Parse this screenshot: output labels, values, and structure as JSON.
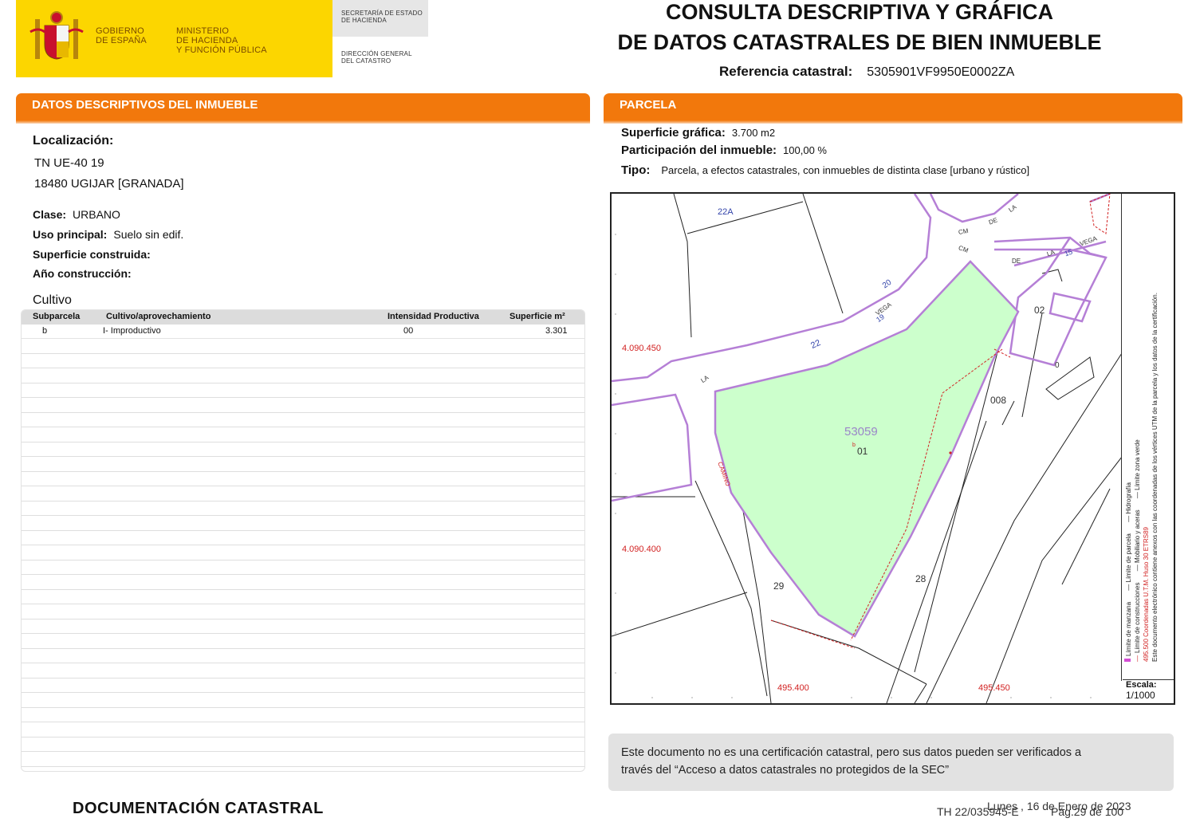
{
  "header": {
    "gov_line1": "GOBIERNO",
    "gov_line2": "DE ESPAÑA",
    "min_line1": "MINISTERIO",
    "min_line2": "DE HACIENDA",
    "min_line3": "Y FUNCIÓN PÚBLICA",
    "sec_line1": "SECRETARÍA DE ESTADO",
    "sec_line2": "DE HACIENDA",
    "dir_line1": "DIRECCIÓN GENERAL",
    "dir_line2": "DEL CATASTRO",
    "title_line1": "CONSULTA DESCRIPTIVA Y GRÁFICA",
    "title_line2": "DE DATOS CATASTRALES DE BIEN INMUEBLE",
    "ref_label": "Referencia catastral:",
    "ref_value": "5305901VF9950E0002ZA"
  },
  "descriptive": {
    "section_title": "DATOS DESCRIPTIVOS DEL INMUEBLE",
    "localizacion_label": "Localización:",
    "address_line1": "TN UE-40 19",
    "address_line2": "18480 UGIJAR [GRANADA]",
    "clase_label": "Clase:",
    "clase_value": "URBANO",
    "uso_label": "Uso principal:",
    "uso_value": "Suelo sin edif.",
    "superficie_label": "Superficie construida:",
    "anio_label": "Año construcción:",
    "cultivo_label": "Cultivo",
    "table": {
      "headers": [
        "Subparcela",
        "Cultivo/aprovechamiento",
        "Intensidad Productiva",
        "Superficie m²"
      ],
      "rows": [
        [
          "b",
          "I- Improductivo",
          "00",
          "3.301"
        ]
      ]
    }
  },
  "parcela": {
    "section_title": "PARCELA",
    "sup_label": "Superficie gráfica:",
    "sup_value": "3.700 m2",
    "part_label": "Participación del inmueble:",
    "part_value": "100,00 %",
    "tipo_label": "Tipo:",
    "tipo_value": "Parcela, a efectos catastrales, con inmuebles de distinta clase [urbano y rústico]",
    "map": {
      "parcel_id": "53059",
      "parcel_sub": "01",
      "sub_letter": "b",
      "coord_y1": "4.090.450",
      "coord_y2": "4.090.400",
      "coord_x1": "495.400",
      "coord_x2": "495.450",
      "labels": [
        "22A",
        "CM",
        "DE",
        "LA",
        "VEGA",
        "15",
        "CM",
        "DE",
        "LA",
        "VEGA",
        "02",
        "20",
        "VEGA",
        "19",
        "22",
        "LA",
        "008",
        "0",
        "CAMINO",
        "29",
        "28"
      ]
    },
    "legend": {
      "line1": "Límite de manzana",
      "line2": "Límite de parcela",
      "line3": "Hidrografía",
      "line4": "Límite de construcciones",
      "line5": "Mobiliario y aceras",
      "line6": "Límite zona verde",
      "line7": "495.500 Coordenadas U.T.M. Huso 30 ETRS89",
      "line8": "Este documento electrónico contiene anexos con las coordenadas de los vértices UTM de la parcela y los datos de la certificación."
    },
    "scale_label": "Escala:",
    "scale_value": "1/1000"
  },
  "note": {
    "line1": "Este documento no es una certificación catastral, pero sus datos pueden ser verificados a",
    "line2": "través del “Acceso a datos catastrales no protegidos de la SEC”"
  },
  "footer": {
    "title": "DOCUMENTACIÓN CATASTRAL",
    "code": "TH 22/035945-E",
    "date": "Lunes , 16 de Enero de 2023",
    "page": "Pág.29 de 100"
  },
  "colors": {
    "header_yellow": "#fcd600",
    "section_orange": "#f2780c",
    "parcel_green": "#ccffcc",
    "block_purple": "#b57fd6",
    "coord_red": "#d22222"
  }
}
